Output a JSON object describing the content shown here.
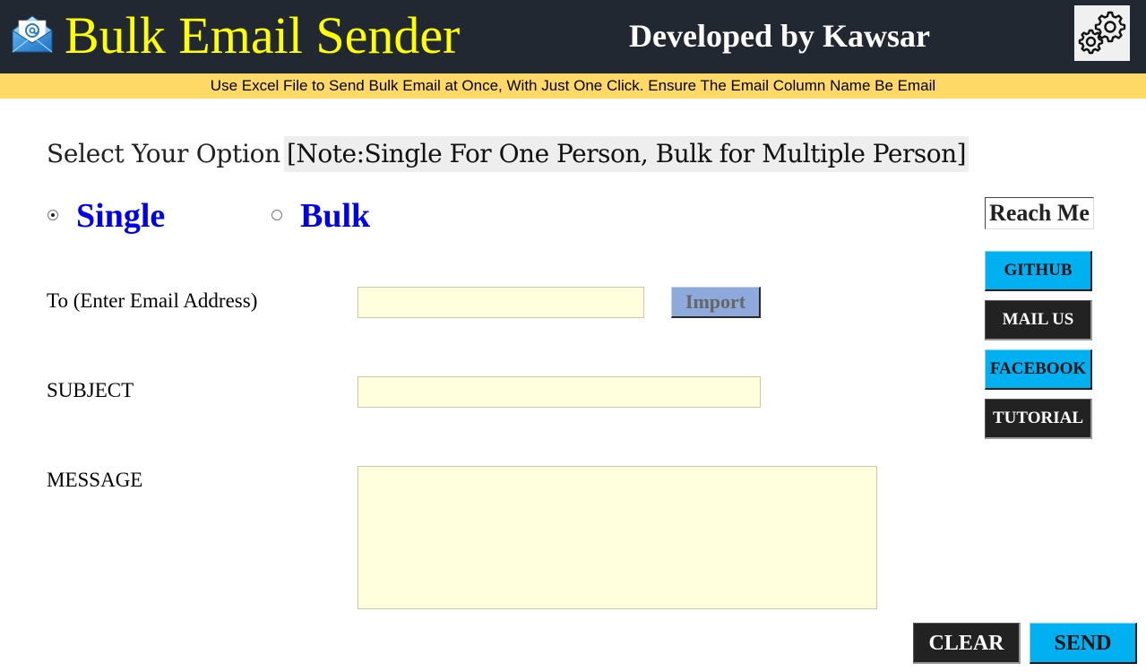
{
  "header": {
    "title": "Bulk Email Sender",
    "developer": "Developed by Kawsar",
    "logo_icon": "email-envelope-icon",
    "settings_icon": "gear-icon"
  },
  "banner": {
    "text": "Use Excel File to Send Bulk Email at Once, With Just One Click. Ensure The Email Column Name Be Email"
  },
  "options": {
    "label": "Select Your Option",
    "note": "[Note:Single For One Person, Bulk for Multiple Person]",
    "choices": [
      {
        "label": "Single",
        "selected": true
      },
      {
        "label": "Bulk",
        "selected": false
      }
    ]
  },
  "form": {
    "to_label": "To (Enter Email Address)",
    "to_value": "",
    "import_label": "Import",
    "subject_label": "SUBJECT",
    "subject_value": "",
    "message_label": "MESSAGE",
    "message_value": ""
  },
  "reach": {
    "title": "Reach Me",
    "links": [
      "GITHUB",
      "MAIL US",
      "FACEBOOK",
      "TUTORIAL"
    ]
  },
  "actions": {
    "clear_label": "CLEAR",
    "send_label": "SEND"
  },
  "colors": {
    "header_bg": "#222831",
    "title": "#ffff00",
    "banner_bg": "#ffd966",
    "radio_label": "#0000ee",
    "input_bg": "#ffffdd",
    "cyan_button": "#00b0f0",
    "dark_button": "#222222",
    "import_button": "#8ea9db"
  }
}
